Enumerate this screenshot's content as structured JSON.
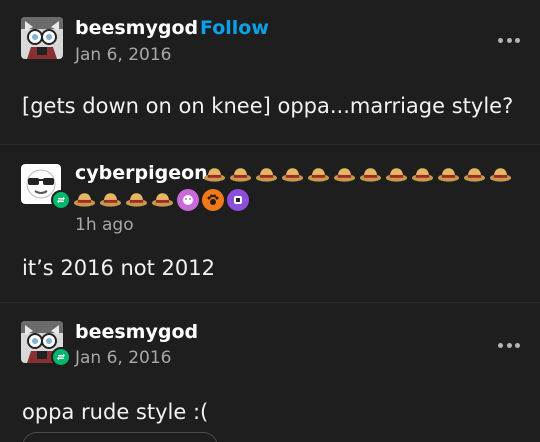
{
  "post": {
    "username": "beesmygod",
    "follow_label": "Follow",
    "date": "Jan 6, 2016",
    "text": "[gets down on on knee] oppa...marriage style?",
    "more_icon": "more-horizontal-icon"
  },
  "reblog1": {
    "username": "cyberpigeon",
    "timestamp": "1h ago",
    "text": "it’s 2016 not 2012",
    "badges": [
      "hat-icon",
      "hat-icon",
      "hat-icon",
      "hat-icon",
      "hat-icon",
      "hat-icon",
      "hat-icon",
      "hat-icon",
      "hat-icon",
      "hat-icon",
      "hat-icon",
      "hat-icon",
      "hat-icon",
      "hat-icon",
      "hat-icon",
      "hat-icon",
      "hat-icon",
      "pink-sticker-icon",
      "orange-paw-icon",
      "purple-sticker-icon"
    ]
  },
  "reblog2": {
    "username": "beesmygod",
    "date": "Jan 6, 2016",
    "text": "oppa rude style :(",
    "more_icon": "more-horizontal-icon"
  },
  "colors": {
    "background": "#1e1e1e",
    "follow_blue": "#0ba0e8",
    "reblog_green": "#00b86b",
    "muted_text": "#a8a8a8"
  }
}
